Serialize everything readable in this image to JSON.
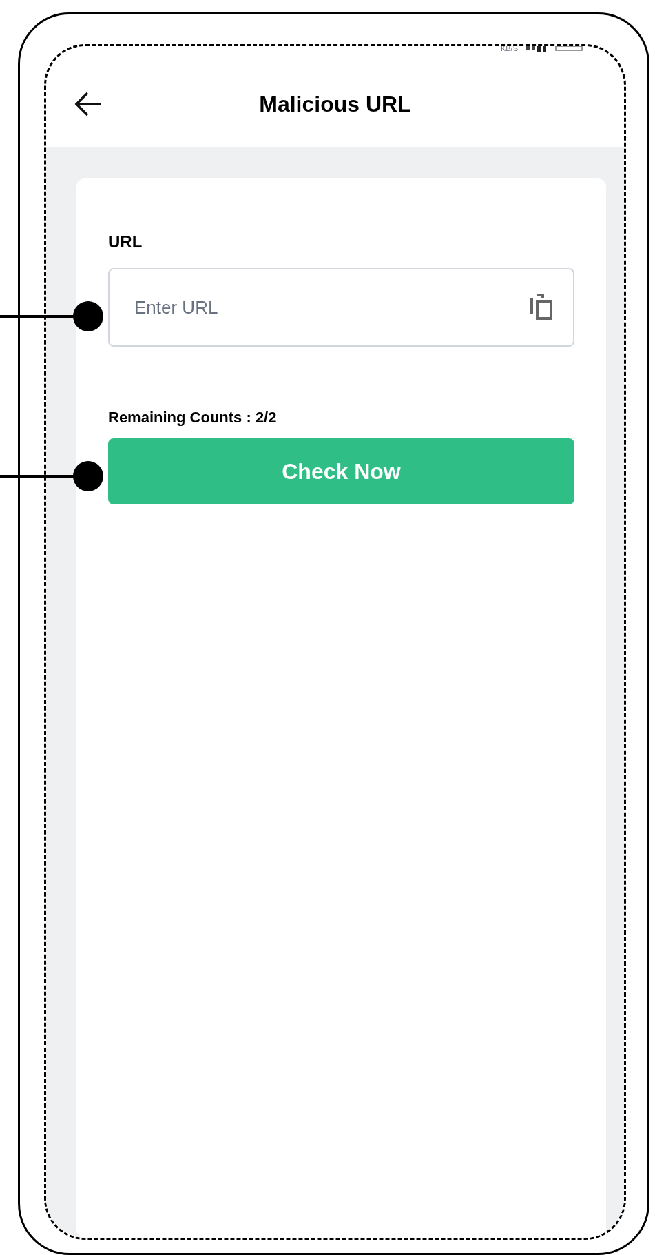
{
  "status_bar": {
    "speed_unit": "KB/S"
  },
  "header": {
    "title": "Malicious URL"
  },
  "form": {
    "url_label": "URL",
    "url_field": {
      "placeholder": "Enter URL"
    },
    "remaining": "Remaining Counts : 2/2",
    "button": "Check Now"
  }
}
